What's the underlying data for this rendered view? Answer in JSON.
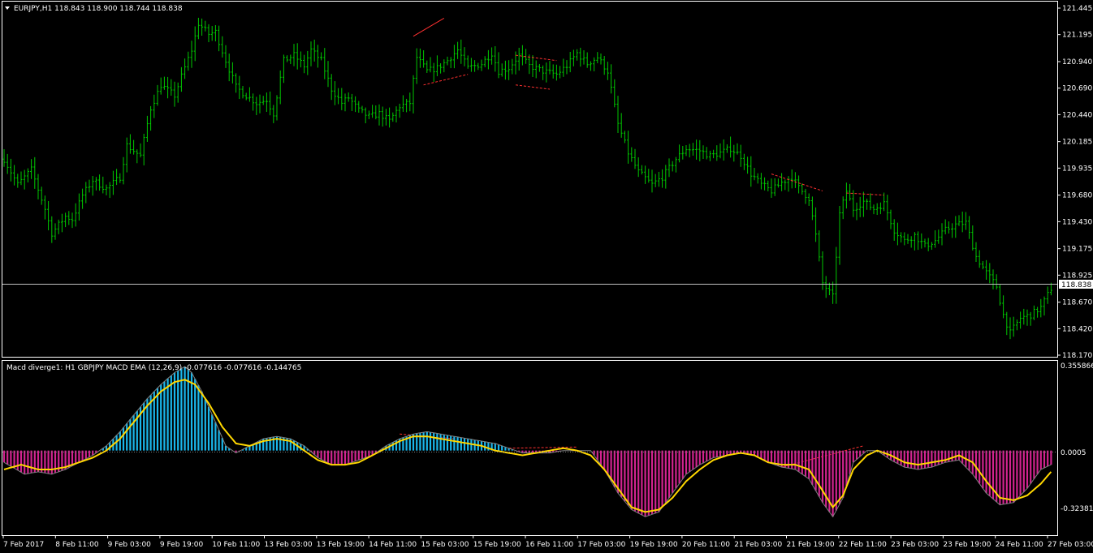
{
  "window": {
    "price_header": "EURJPY,H1  118.843 118.900 118.744 118.838",
    "indicator_header": "Macd diverge1:  H1 GBPJPY MACD EMA (12,26,9) -0.077616 -0.077616 -0.144765"
  },
  "colors": {
    "background": "#000000",
    "frame": "#ffffff",
    "bars": "#00c800",
    "hist_up": "#1ab6ea",
    "hist_down": "#d2238f",
    "signal": "#ffd700",
    "macd_line": "#808080",
    "current_line": "#c0c0c0",
    "divergence": "#ff3030"
  },
  "icons": {
    "header_marker": "triangle-down-icon"
  },
  "price_axis": {
    "ticks": [
      "121.445",
      "121.195",
      "120.940",
      "120.690",
      "120.440",
      "120.185",
      "119.935",
      "119.680",
      "119.430",
      "119.175",
      "118.925",
      "118.670",
      "118.420",
      "118.170"
    ],
    "current_price": "118.838"
  },
  "indicator_axis": {
    "max_label": "0.355866",
    "min_label": "-0.323815",
    "zero_label": "0.0005"
  },
  "time_axis": {
    "labels": [
      "7 Feb 2017",
      "8 Feb 11:00",
      "9 Feb 03:00",
      "9 Feb 19:00",
      "10 Feb 11:00",
      "13 Feb 03:00",
      "13 Feb 19:00",
      "14 Feb 11:00",
      "15 Feb 03:00",
      "15 Feb 19:00",
      "16 Feb 11:00",
      "17 Feb 03:00",
      "19 Feb 19:00",
      "20 Feb 11:00",
      "21 Feb 03:00",
      "21 Feb 19:00",
      "22 Feb 11:00",
      "23 Feb 03:00",
      "23 Feb 19:00",
      "24 Feb 11:00",
      "27 Feb 03:00"
    ]
  },
  "chart_data": [
    {
      "type": "ohlc",
      "symbol": "EURJPY",
      "timeframe": "H1",
      "ylim": [
        118.17,
        121.445
      ],
      "last": 118.838,
      "close_path": [
        [
          0,
          120.02
        ],
        [
          4,
          119.78
        ],
        [
          8,
          119.92
        ],
        [
          12,
          119.55
        ],
        [
          14,
          119.32
        ],
        [
          18,
          119.48
        ],
        [
          20,
          119.45
        ],
        [
          23,
          119.68
        ],
        [
          26,
          119.82
        ],
        [
          30,
          119.74
        ],
        [
          34,
          119.85
        ],
        [
          36,
          120.15
        ],
        [
          40,
          120.05
        ],
        [
          43,
          120.5
        ],
        [
          46,
          120.72
        ],
        [
          50,
          120.62
        ],
        [
          52,
          120.8
        ],
        [
          55,
          121.05
        ],
        [
          57,
          121.3
        ],
        [
          60,
          121.2
        ],
        [
          62,
          121.22
        ],
        [
          65,
          120.95
        ],
        [
          68,
          120.7
        ],
        [
          71,
          120.62
        ],
        [
          74,
          120.55
        ],
        [
          77,
          120.58
        ],
        [
          79,
          120.45
        ],
        [
          82,
          120.95
        ],
        [
          85,
          121.0
        ],
        [
          88,
          120.9
        ],
        [
          90,
          121.05
        ],
        [
          93,
          120.95
        ],
        [
          96,
          120.68
        ],
        [
          99,
          120.55
        ],
        [
          101,
          120.6
        ],
        [
          104,
          120.48
        ],
        [
          107,
          120.42
        ],
        [
          110,
          120.45
        ],
        [
          113,
          120.38
        ],
        [
          116,
          120.52
        ],
        [
          119,
          120.55
        ],
        [
          121,
          120.98
        ],
        [
          124,
          120.85
        ],
        [
          127,
          120.88
        ],
        [
          130,
          120.95
        ],
        [
          133,
          121.05
        ],
        [
          136,
          120.88
        ],
        [
          140,
          120.92
        ],
        [
          143,
          121.02
        ],
        [
          145,
          120.85
        ],
        [
          148,
          120.88
        ],
        [
          151,
          121.0
        ],
        [
          154,
          120.9
        ],
        [
          158,
          120.85
        ],
        [
          162,
          120.82
        ],
        [
          165,
          120.9
        ],
        [
          168,
          121.02
        ],
        [
          171,
          120.92
        ],
        [
          174,
          120.98
        ],
        [
          177,
          120.85
        ],
        [
          180,
          120.35
        ],
        [
          183,
          120.08
        ],
        [
          186,
          119.9
        ],
        [
          190,
          119.78
        ],
        [
          193,
          119.85
        ],
        [
          197,
          120.02
        ],
        [
          200,
          120.12
        ],
        [
          204,
          120.1
        ],
        [
          207,
          120.05
        ],
        [
          210,
          120.08
        ],
        [
          213,
          120.12
        ],
        [
          216,
          120.05
        ],
        [
          219,
          119.88
        ],
        [
          222,
          119.78
        ],
        [
          225,
          119.72
        ],
        [
          228,
          119.8
        ],
        [
          231,
          119.85
        ],
        [
          233,
          119.75
        ],
        [
          236,
          119.65
        ],
        [
          238,
          119.3
        ],
        [
          240,
          118.85
        ],
        [
          243,
          118.72
        ],
        [
          245,
          119.5
        ],
        [
          247,
          119.72
        ],
        [
          249,
          119.55
        ],
        [
          252,
          119.62
        ],
        [
          255,
          119.55
        ],
        [
          258,
          119.6
        ],
        [
          261,
          119.35
        ],
        [
          264,
          119.25
        ],
        [
          267,
          119.3
        ],
        [
          270,
          119.2
        ],
        [
          273,
          119.25
        ],
        [
          276,
          119.35
        ],
        [
          279,
          119.4
        ],
        [
          282,
          119.42
        ],
        [
          285,
          119.1
        ],
        [
          288,
          118.95
        ],
        [
          291,
          118.82
        ],
        [
          293,
          118.55
        ],
        [
          295,
          118.38
        ],
        [
          298,
          118.52
        ],
        [
          301,
          118.55
        ],
        [
          304,
          118.62
        ],
        [
          307,
          118.8
        ]
      ]
    },
    {
      "type": "line",
      "name": "MACD EMA (12,26,9)",
      "values": [
        -0.077616,
        -0.077616,
        -0.144765
      ],
      "ylim": [
        -0.323815,
        0.355866
      ],
      "macd_path": [
        [
          0,
          -0.05
        ],
        [
          6,
          -0.1
        ],
        [
          10,
          -0.09
        ],
        [
          14,
          -0.1
        ],
        [
          18,
          -0.08
        ],
        [
          22,
          -0.05
        ],
        [
          26,
          -0.02
        ],
        [
          30,
          0.02
        ],
        [
          34,
          0.08
        ],
        [
          38,
          0.15
        ],
        [
          42,
          0.22
        ],
        [
          46,
          0.28
        ],
        [
          50,
          0.33
        ],
        [
          53,
          0.356
        ],
        [
          55,
          0.33
        ],
        [
          58,
          0.25
        ],
        [
          62,
          0.12
        ],
        [
          65,
          0.02
        ],
        [
          68,
          -0.01
        ],
        [
          72,
          0.02
        ],
        [
          76,
          0.05
        ],
        [
          80,
          0.06
        ],
        [
          84,
          0.05
        ],
        [
          88,
          0.02
        ],
        [
          92,
          -0.03
        ],
        [
          96,
          -0.06
        ],
        [
          100,
          -0.06
        ],
        [
          104,
          -0.04
        ],
        [
          108,
          -0.02
        ],
        [
          112,
          0.02
        ],
        [
          116,
          0.05
        ],
        [
          120,
          0.07
        ],
        [
          124,
          0.08
        ],
        [
          128,
          0.07
        ],
        [
          132,
          0.06
        ],
        [
          136,
          0.05
        ],
        [
          140,
          0.04
        ],
        [
          144,
          0.03
        ],
        [
          148,
          0.01
        ],
        [
          152,
          -0.01
        ],
        [
          156,
          -0.01
        ],
        [
          160,
          -0.01
        ],
        [
          164,
          0.0
        ],
        [
          168,
          0.0
        ],
        [
          172,
          0.0
        ],
        [
          176,
          -0.08
        ],
        [
          180,
          -0.18
        ],
        [
          184,
          -0.25
        ],
        [
          188,
          -0.28
        ],
        [
          192,
          -0.26
        ],
        [
          196,
          -0.18
        ],
        [
          200,
          -0.1
        ],
        [
          204,
          -0.06
        ],
        [
          208,
          -0.03
        ],
        [
          212,
          -0.02
        ],
        [
          216,
          -0.01
        ],
        [
          220,
          -0.02
        ],
        [
          224,
          -0.05
        ],
        [
          228,
          -0.07
        ],
        [
          232,
          -0.08
        ],
        [
          236,
          -0.12
        ],
        [
          240,
          -0.22
        ],
        [
          243,
          -0.28
        ],
        [
          246,
          -0.2
        ],
        [
          249,
          -0.05
        ],
        [
          253,
          0.0
        ],
        [
          256,
          0.0
        ],
        [
          260,
          -0.04
        ],
        [
          264,
          -0.07
        ],
        [
          268,
          -0.08
        ],
        [
          272,
          -0.07
        ],
        [
          276,
          -0.05
        ],
        [
          280,
          -0.04
        ],
        [
          284,
          -0.1
        ],
        [
          288,
          -0.18
        ],
        [
          292,
          -0.23
        ],
        [
          296,
          -0.22
        ],
        [
          300,
          -0.16
        ],
        [
          304,
          -0.08
        ],
        [
          307,
          -0.06
        ]
      ],
      "signal_path": [
        [
          0,
          -0.08
        ],
        [
          5,
          -0.06
        ],
        [
          10,
          -0.08
        ],
        [
          14,
          -0.08
        ],
        [
          18,
          -0.07
        ],
        [
          22,
          -0.05
        ],
        [
          26,
          -0.03
        ],
        [
          30,
          0.0
        ],
        [
          34,
          0.05
        ],
        [
          38,
          0.12
        ],
        [
          42,
          0.19
        ],
        [
          46,
          0.25
        ],
        [
          50,
          0.29
        ],
        [
          53,
          0.3
        ],
        [
          56,
          0.28
        ],
        [
          60,
          0.2
        ],
        [
          64,
          0.1
        ],
        [
          68,
          0.03
        ],
        [
          72,
          0.02
        ],
        [
          76,
          0.04
        ],
        [
          80,
          0.05
        ],
        [
          84,
          0.04
        ],
        [
          88,
          0.0
        ],
        [
          92,
          -0.04
        ],
        [
          96,
          -0.06
        ],
        [
          100,
          -0.06
        ],
        [
          104,
          -0.05
        ],
        [
          108,
          -0.02
        ],
        [
          112,
          0.01
        ],
        [
          116,
          0.04
        ],
        [
          120,
          0.06
        ],
        [
          124,
          0.06
        ],
        [
          128,
          0.05
        ],
        [
          132,
          0.04
        ],
        [
          136,
          0.03
        ],
        [
          140,
          0.02
        ],
        [
          144,
          0.0
        ],
        [
          148,
          -0.01
        ],
        [
          152,
          -0.02
        ],
        [
          156,
          -0.01
        ],
        [
          160,
          0.0
        ],
        [
          164,
          0.01
        ],
        [
          168,
          0.0
        ],
        [
          172,
          -0.02
        ],
        [
          176,
          -0.08
        ],
        [
          180,
          -0.16
        ],
        [
          184,
          -0.24
        ],
        [
          188,
          -0.26
        ],
        [
          192,
          -0.25
        ],
        [
          196,
          -0.2
        ],
        [
          200,
          -0.13
        ],
        [
          204,
          -0.08
        ],
        [
          208,
          -0.04
        ],
        [
          212,
          -0.02
        ],
        [
          216,
          -0.01
        ],
        [
          220,
          -0.02
        ],
        [
          224,
          -0.05
        ],
        [
          228,
          -0.06
        ],
        [
          232,
          -0.06
        ],
        [
          236,
          -0.08
        ],
        [
          240,
          -0.17
        ],
        [
          243,
          -0.24
        ],
        [
          246,
          -0.19
        ],
        [
          249,
          -0.08
        ],
        [
          253,
          -0.02
        ],
        [
          256,
          0.0
        ],
        [
          260,
          -0.02
        ],
        [
          264,
          -0.05
        ],
        [
          268,
          -0.06
        ],
        [
          272,
          -0.05
        ],
        [
          276,
          -0.04
        ],
        [
          280,
          -0.02
        ],
        [
          284,
          -0.05
        ],
        [
          288,
          -0.13
        ],
        [
          292,
          -0.2
        ],
        [
          296,
          -0.21
        ],
        [
          300,
          -0.19
        ],
        [
          304,
          -0.14
        ],
        [
          307,
          -0.09
        ]
      ]
    }
  ]
}
